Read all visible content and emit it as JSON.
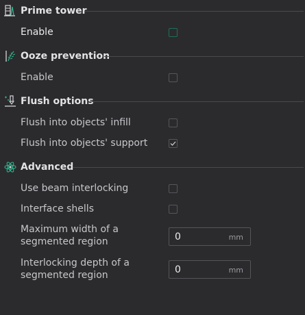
{
  "sections": [
    {
      "title": "Prime tower",
      "icon": "prime-tower-icon",
      "options": [
        {
          "label": "Enable",
          "type": "checkbox",
          "checked": false,
          "focused": true
        }
      ]
    },
    {
      "title": "Ooze prevention",
      "icon": "ooze-prevention-icon",
      "options": [
        {
          "label": "Enable",
          "type": "checkbox",
          "checked": false
        }
      ]
    },
    {
      "title": "Flush options",
      "icon": "flush-options-icon",
      "options": [
        {
          "label": "Flush into objects' infill",
          "type": "checkbox",
          "checked": false
        },
        {
          "label": "Flush into objects' support",
          "type": "checkbox",
          "checked": true
        }
      ]
    },
    {
      "title": "Advanced",
      "icon": "advanced-atom-icon",
      "options": [
        {
          "label": "Use beam interlocking",
          "type": "checkbox",
          "checked": false
        },
        {
          "label": "Interface shells",
          "type": "checkbox",
          "checked": false
        },
        {
          "label_line1": "Maximum width of a",
          "label_line2": "segmented region",
          "type": "number",
          "value": "0",
          "unit": "mm"
        },
        {
          "label_line1": "Interlocking depth of a",
          "label_line2": "segmented region",
          "type": "number",
          "value": "0",
          "unit": "mm"
        }
      ]
    }
  ],
  "colors": {
    "background": "#2b2b2e",
    "accent": "#1e6f5c",
    "divider": "#4a4a4f"
  }
}
